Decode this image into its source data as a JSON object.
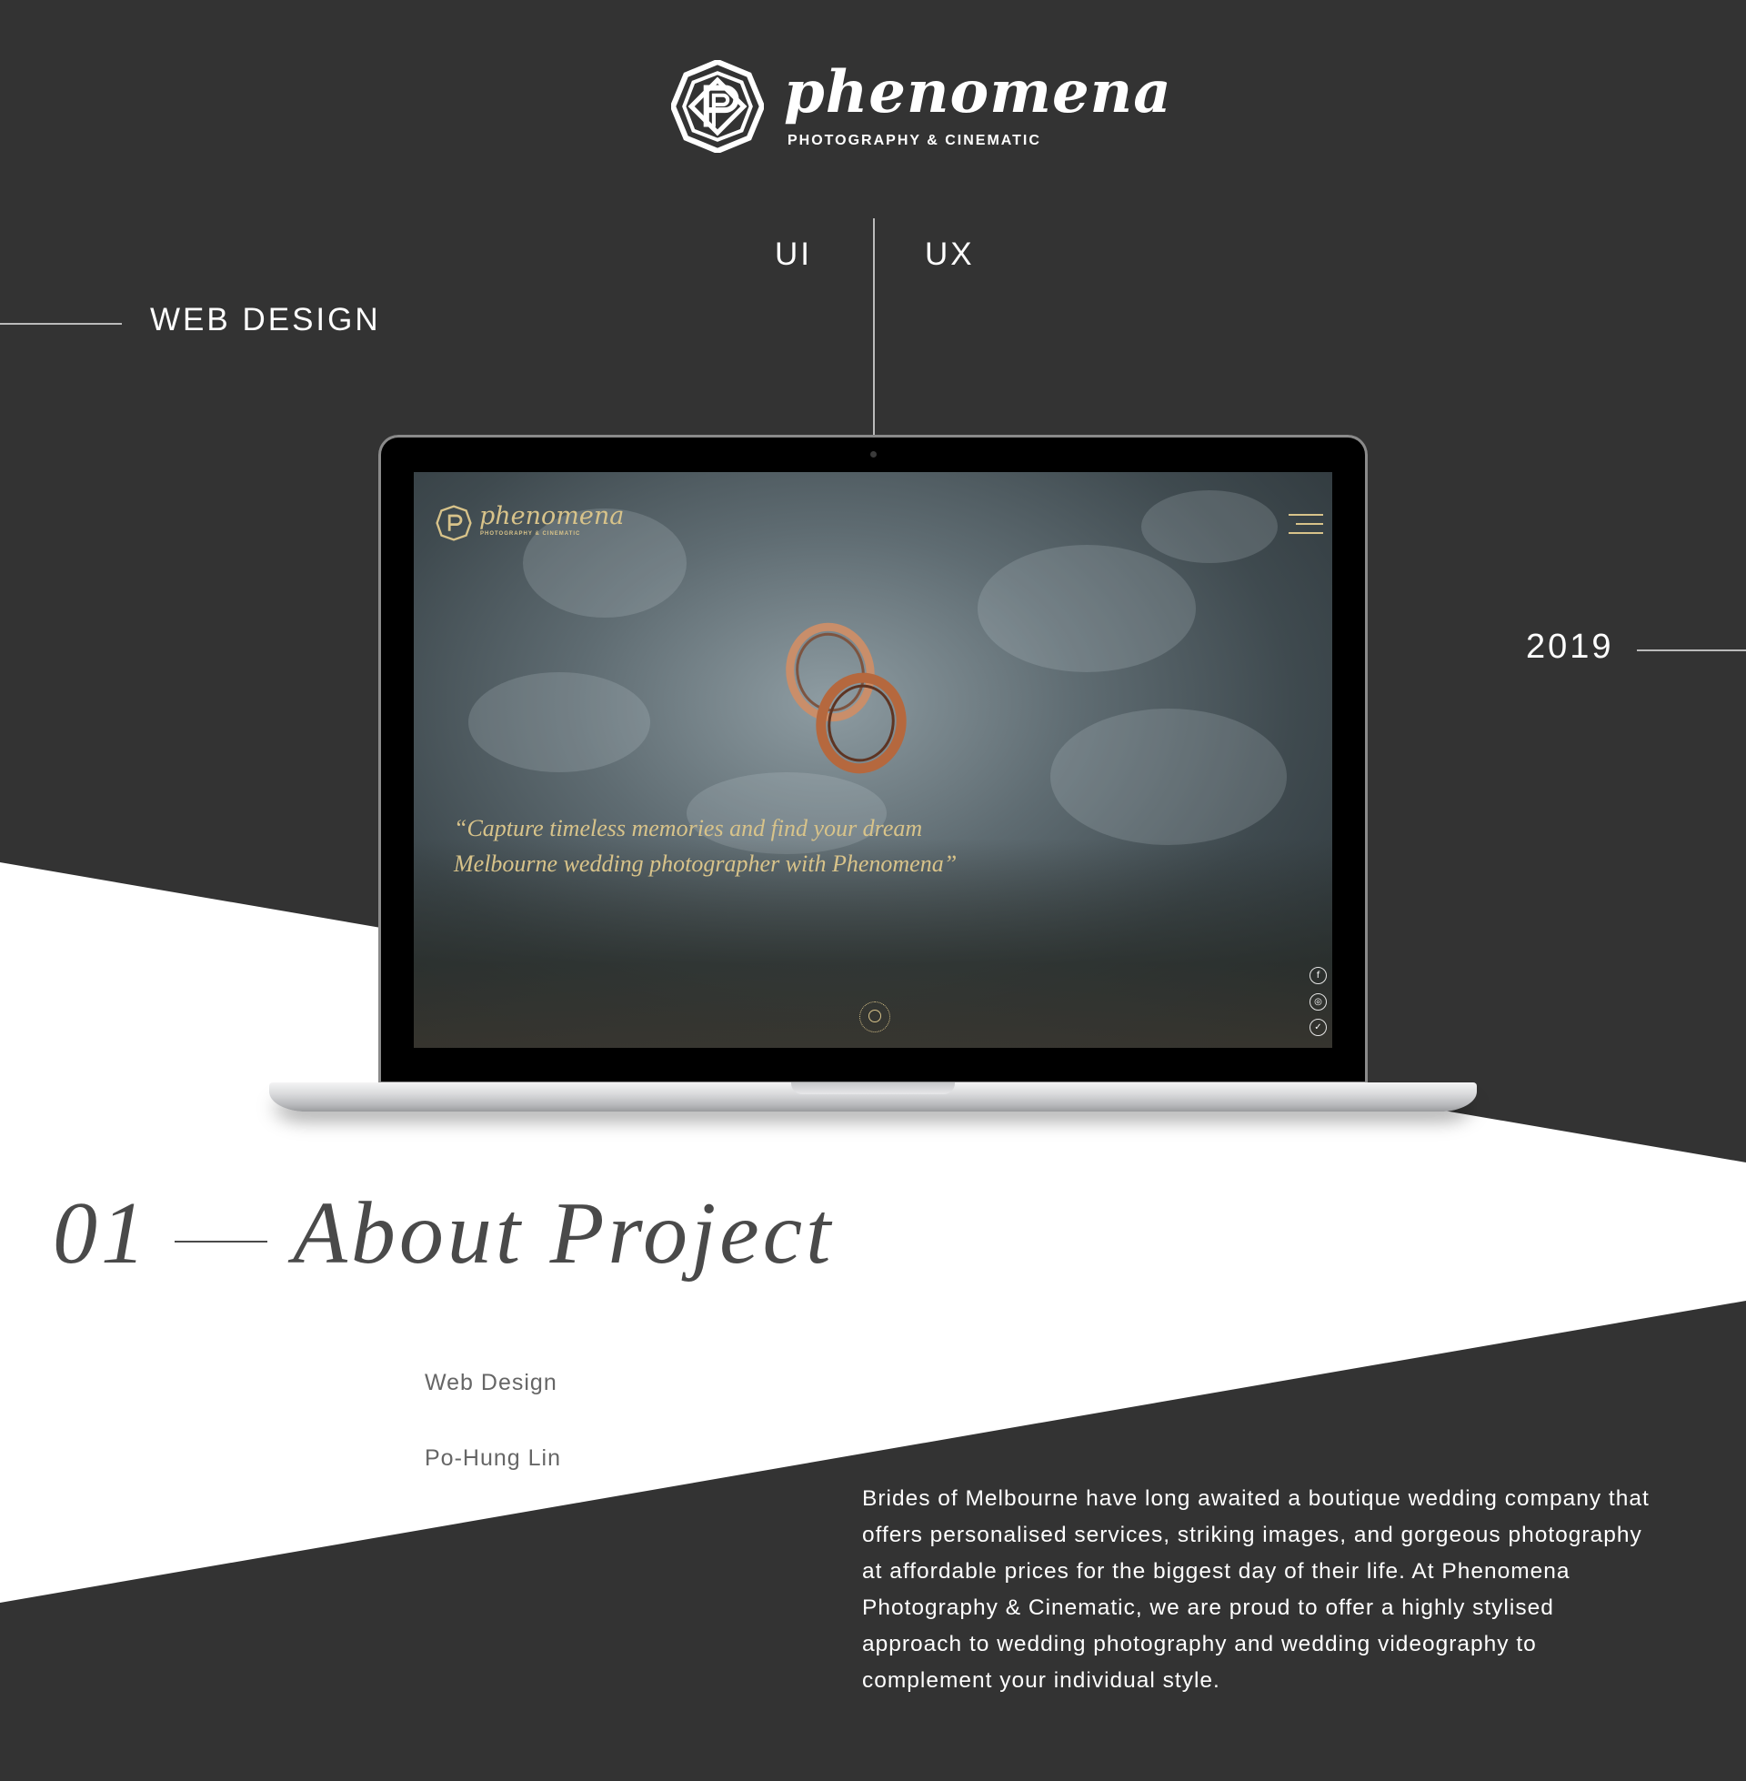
{
  "brand": {
    "name": "phenomena",
    "tagline": "PHOTOGRAPHY & CINEMATIC"
  },
  "tags": {
    "ui": "UI",
    "ux": "UX",
    "category": "WEB DESIGN",
    "year": "2019"
  },
  "screen": {
    "logo_name": "phenomena",
    "logo_tagline": "PHOTOGRAPHY & CINEMATIC",
    "quote_line1": "“Capture timeless memories and find your dream",
    "quote_line2": "Melbourne wedding photographer with Phenomena”",
    "social": [
      {
        "icon": "facebook-icon",
        "glyph": "f"
      },
      {
        "icon": "instagram-icon",
        "glyph": "◎"
      },
      {
        "icon": "twitter-icon",
        "glyph": "✓"
      }
    ],
    "accent_color": "#d8c38a"
  },
  "about": {
    "number": "01",
    "title": "About Project",
    "role": "Web Design",
    "author": "Po-Hung Lin",
    "description": "Brides of Melbourne have long awaited a boutique wedding company that offers personalised services, striking images, and gorgeous photography at affordable prices for the biggest day of their life. At Phenomena Photography & Cinematic, we are proud to offer a highly stylised approach to wedding photography and wedding videography to complement your individual style."
  },
  "colors": {
    "background": "#333333",
    "band": "#ffffff",
    "title_text": "#4a4a4a"
  }
}
